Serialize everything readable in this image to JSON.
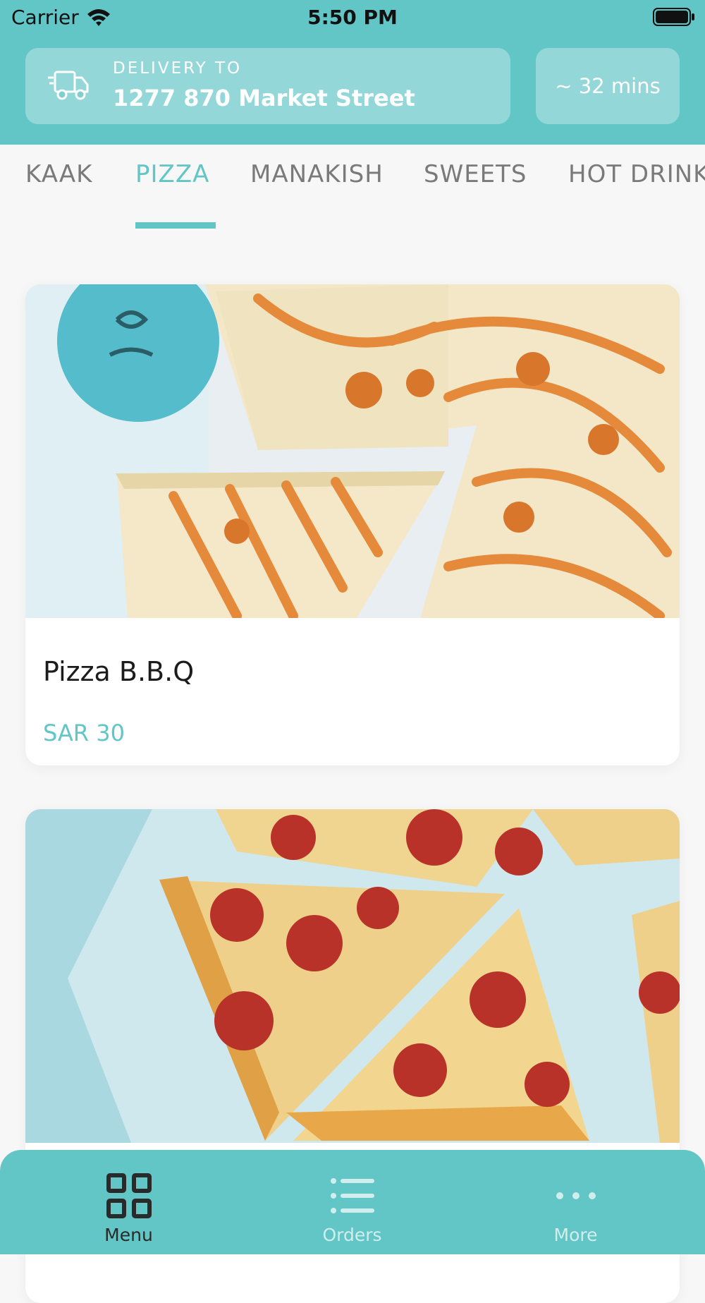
{
  "status_bar": {
    "carrier": "Carrier",
    "time": "5:50 PM"
  },
  "delivery": {
    "label": "DELIVERY TO",
    "address": "1277 870 Market Street",
    "eta": "~ 32 mins",
    "icon": "truck-icon"
  },
  "categories": {
    "active": "PIZZA",
    "items": [
      "KAAK",
      "PIZZA",
      "MANAKISH",
      "SWEETS",
      "HOT DRINK"
    ]
  },
  "products": [
    {
      "name": "Pizza B.B.Q",
      "price": "SAR 30"
    }
  ],
  "tabbar": {
    "active": "Menu",
    "items": [
      {
        "label": "Menu",
        "icon": "grid-icon"
      },
      {
        "label": "Orders",
        "icon": "list-icon"
      },
      {
        "label": "More",
        "icon": "more-dots-icon"
      }
    ]
  },
  "colors": {
    "accent": "#62c5c6",
    "background": "#f7f7f7"
  }
}
